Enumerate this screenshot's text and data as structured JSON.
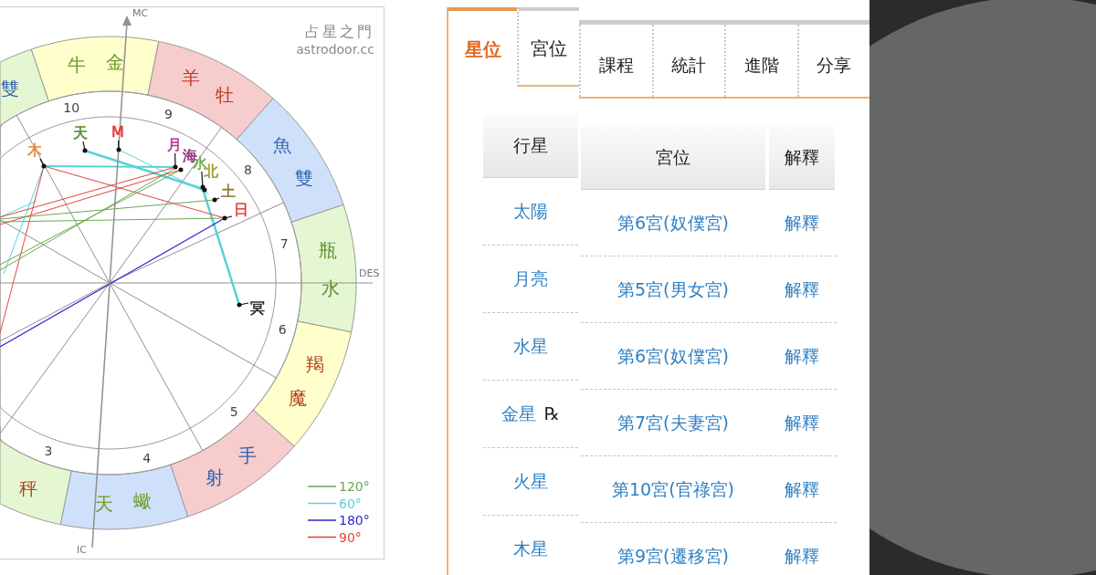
{
  "chart": {
    "brand": {
      "title": "占星之門",
      "site": "astrodoor.cc"
    },
    "axis_labels": {
      "top": "MC",
      "bottom": "IC",
      "right": "DES"
    },
    "signs": [
      {
        "glyphs": [
          "雙"
        ],
        "color": "#e4f7d2"
      },
      {
        "glyphs": [
          "牛",
          "金"
        ],
        "color": "#ffffcc"
      },
      {
        "glyphs": [
          "羊",
          "牡"
        ],
        "color": "#f6cccc"
      },
      {
        "glyphs": [
          "魚",
          "雙"
        ],
        "color": "#cfe0fa"
      },
      {
        "glyphs": [
          "瓶",
          "水"
        ],
        "color": "#e4f7d2"
      },
      {
        "glyphs": [
          "羯",
          "魔"
        ],
        "color": "#ffffcc"
      },
      {
        "glyphs": [
          "手",
          "射"
        ],
        "color": "#f6cccc"
      },
      {
        "glyphs": [
          "天",
          "蠍"
        ],
        "color": "#cfe0fa"
      },
      {
        "glyphs": [
          "秤"
        ],
        "color": "#e4f7d2"
      }
    ],
    "houses": [
      "10",
      "9",
      "8",
      "7",
      "6",
      "5",
      "4",
      "3"
    ],
    "planets": [
      {
        "glyph": "木",
        "color": "#e8883a"
      },
      {
        "glyph": "天",
        "color": "#4a8a2a"
      },
      {
        "glyph": "M",
        "color": "#e53935"
      },
      {
        "glyph": "月",
        "color": "#b0308a"
      },
      {
        "glyph": "海",
        "color": "#8a2a7a"
      },
      {
        "glyph": "水",
        "color": "#6aa84f"
      },
      {
        "glyph": "北",
        "color": "#9a9a2a"
      },
      {
        "glyph": "土",
        "color": "#8a7a2a"
      },
      {
        "glyph": "日",
        "color": "#e53935"
      },
      {
        "glyph": "冥",
        "color": "#222222"
      }
    ],
    "legend": [
      {
        "label": "120°",
        "color": "#6aa84f"
      },
      {
        "label": "60°",
        "color": "#5ad1d9"
      },
      {
        "label": "180°",
        "color": "#2b2bcc"
      },
      {
        "label": "90°",
        "color": "#e0453a"
      }
    ]
  },
  "planet_panel": {
    "tabs": [
      {
        "label": "星位",
        "selected": true
      },
      {
        "label": "宮位",
        "selected": false
      }
    ],
    "column": "行星",
    "rows": [
      {
        "planet": "太陽"
      },
      {
        "planet": "月亮"
      },
      {
        "planet": "水星"
      },
      {
        "planet": "金星",
        "retrograde_mark": "℞"
      },
      {
        "planet": "火星"
      },
      {
        "planet": "木星"
      }
    ]
  },
  "house_panel": {
    "tabs": [
      {
        "label": "課程",
        "selected": false
      },
      {
        "label": "統計",
        "selected": false
      },
      {
        "label": "進階",
        "selected": false
      },
      {
        "label": "分享",
        "selected": false
      }
    ],
    "columns": [
      "宮位",
      "解釋"
    ],
    "rows": [
      {
        "house": "第6宮(奴僕宮)",
        "action": "解釋"
      },
      {
        "house": "第5宮(男女宮)",
        "action": "解釋"
      },
      {
        "house": "第6宮(奴僕宮)",
        "action": "解釋"
      },
      {
        "house": "第7宮(夫妻宮)",
        "action": "解釋"
      },
      {
        "house": "第10宮(官祿宮)",
        "action": "解釋"
      },
      {
        "house": "第9宮(遷移宮)",
        "action": "解釋"
      }
    ]
  }
}
